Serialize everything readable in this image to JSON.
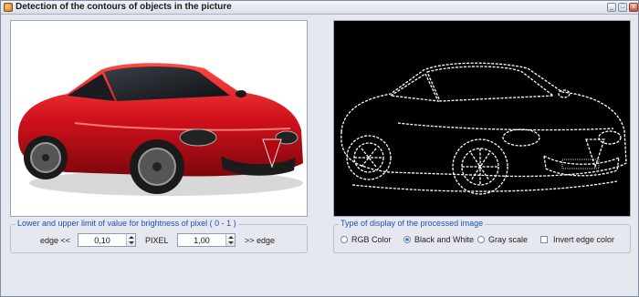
{
  "window": {
    "title": "Detection of the contours of objects in the picture",
    "controls": [
      "_",
      "□",
      "x"
    ]
  },
  "brightness_group": {
    "legend": "Lower and upper limit of value for brightness of pixel ( 0 - 1 )",
    "left_label": "edge  <<",
    "lower_value": "0,10",
    "middle_label": "PIXEL",
    "upper_value": "1,00",
    "right_label": ">> edge"
  },
  "display_group": {
    "legend": "Type of display of the processed image",
    "options": [
      {
        "label": "RGB Color",
        "selected": false
      },
      {
        "label": "Black and White",
        "selected": true
      },
      {
        "label": "Gray scale",
        "selected": false
      }
    ],
    "invert_label": "Invert edge color",
    "invert_checked": false
  },
  "colors": {
    "car_body": "#d0111c",
    "edge_lines": "#ffffff",
    "legend_text": "#1f4fb8"
  }
}
